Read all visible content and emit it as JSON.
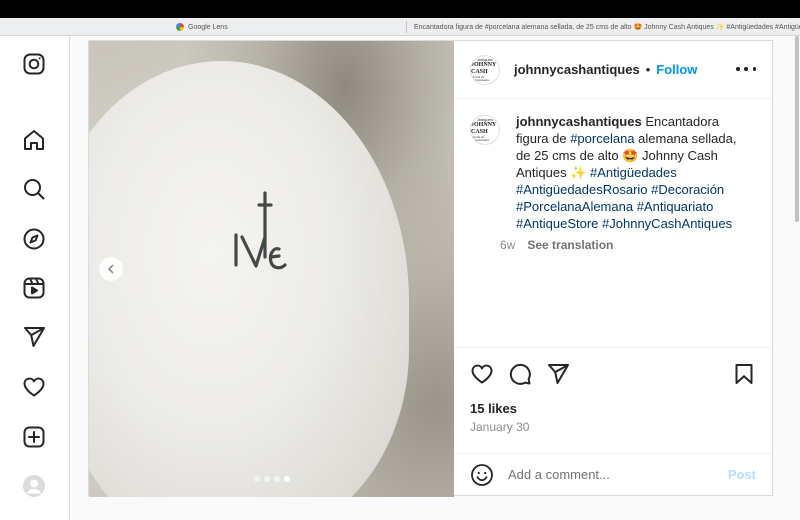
{
  "browser": {
    "tabs": [
      {
        "title": "Google Lens",
        "icon": "google-icon"
      },
      {
        "title": "Encantadora figura de #porcelana alemana sellada, de 25 cms de alto 🤩 Johnny Cash Antiques ✨ #Antigüedades #Antigüeda...",
        "icon": "instagram-icon"
      }
    ]
  },
  "nav": {
    "items": [
      "instagram-logo-icon",
      "home-icon",
      "search-icon",
      "explore-icon",
      "reels-icon",
      "messages-icon",
      "notifications-icon",
      "create-icon",
      "profile-avatar"
    ]
  },
  "post": {
    "image": {
      "mark_text": "KPM-style porcelain mark",
      "dots": 4,
      "active_dot": 4
    },
    "header": {
      "username": "johnnycashantiques",
      "separator": "•",
      "follow_label": "Follow",
      "avatar_lines": [
        "Antiques",
        "JOHNNY CASH",
        "Tienda de Antigüedades"
      ]
    },
    "caption": {
      "username": "johnnycashantiques",
      "text_before": " Encantadora figura de ",
      "tag1": "#porcelana",
      "text_mid": " alemana sellada, de 25 cms de alto 🤩 Johnny Cash Antiques ✨ ",
      "tags": [
        "#Antigüedades",
        "#AntigüedadesRosario",
        "#Decoración",
        "#PorcelanaAlemana",
        "#Antiquariato",
        "#AntiqueStore",
        "#JohnnyCashAntiques"
      ],
      "age": "6w",
      "see_translation": "See translation"
    },
    "likes": "15 likes",
    "date": "January 30",
    "comment": {
      "placeholder": "Add a comment...",
      "post_label": "Post"
    }
  },
  "colors": {
    "link": "#0095f6",
    "hashtag": "#00376b",
    "post_disabled": "#b2dffc"
  }
}
